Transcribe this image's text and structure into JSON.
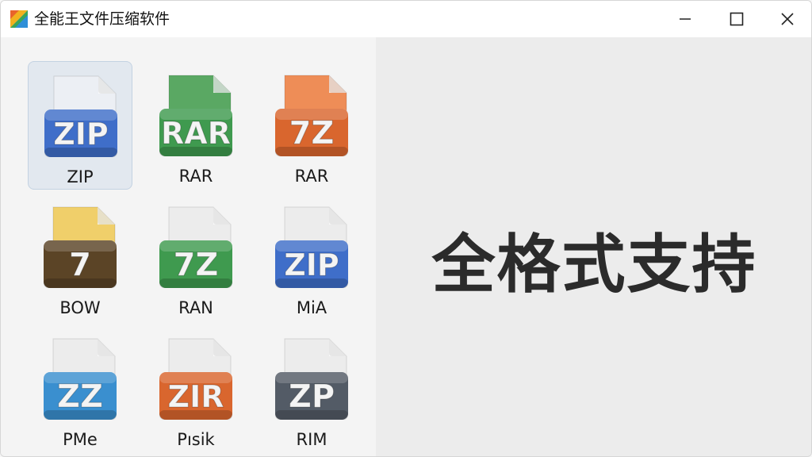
{
  "window": {
    "title": "全能王文件压缩软件",
    "controls": [
      "minimize-icon",
      "maximize-icon",
      "close-icon"
    ]
  },
  "main": {
    "slogan": "全格式支持"
  },
  "formats": [
    {
      "badge": "ZIP",
      "label": "ZIP",
      "color": "#3f6ec9",
      "paper": "#eceff4",
      "selected": true
    },
    {
      "badge": "RAR",
      "label": "RAR",
      "color": "#3f9a4f",
      "paper": "#5aa863",
      "selected": false
    },
    {
      "badge": "7Z",
      "label": "RAR",
      "color": "#d9662e",
      "paper": "#ee8d57",
      "selected": false
    },
    {
      "badge": "7",
      "label": "BOW",
      "color": "#5b4426",
      "paper": "#f0cf6a",
      "selected": false
    },
    {
      "badge": "7Z",
      "label": "RAN",
      "color": "#3f9a4f",
      "paper": "#ececec",
      "selected": false
    },
    {
      "badge": "ZIP",
      "label": "MiA",
      "color": "#3f6ec9",
      "paper": "#ececec",
      "selected": false
    },
    {
      "badge": "ZZ",
      "label": "PMe",
      "color": "#3a8fcf",
      "paper": "#ececec",
      "selected": false
    },
    {
      "badge": "ZIR",
      "label": "Pısik",
      "color": "#d9662e",
      "paper": "#ececec",
      "selected": false
    },
    {
      "badge": "ZP",
      "label": "RIM",
      "color": "#535b66",
      "paper": "#ececec",
      "selected": false
    }
  ]
}
